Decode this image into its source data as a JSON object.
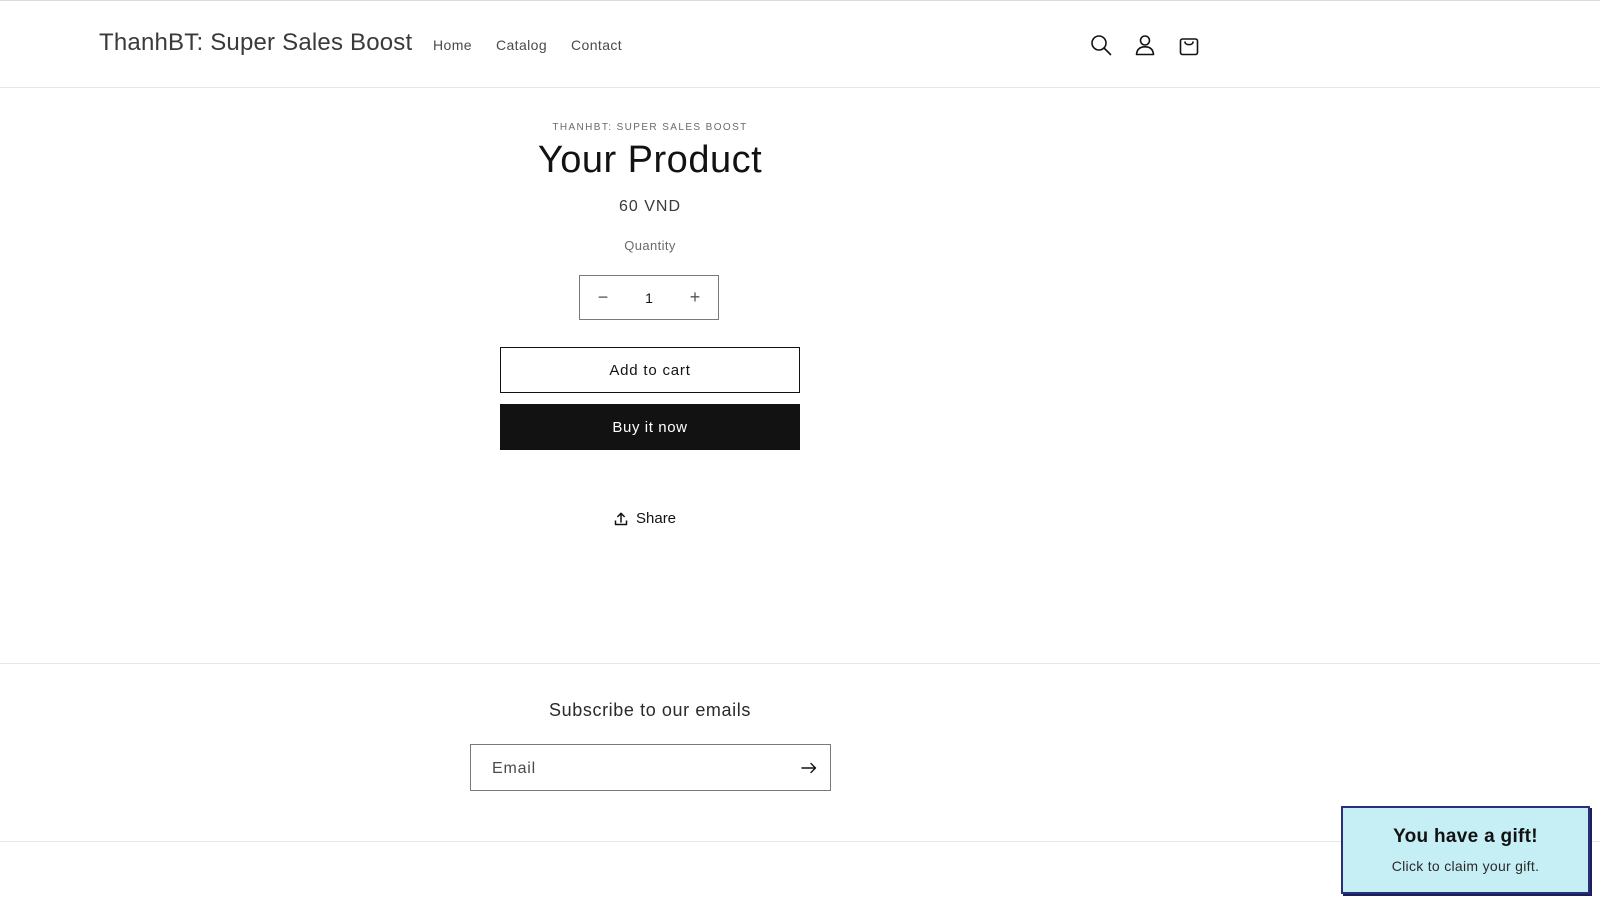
{
  "header": {
    "logo": "ThanhBT: Super Sales Boost",
    "nav": [
      "Home",
      "Catalog",
      "Contact"
    ],
    "icons": [
      "search-icon",
      "account-icon",
      "cart-icon"
    ]
  },
  "product": {
    "vendor": "THANHBT: SUPER SALES BOOST",
    "title": "Your Product",
    "price": "60 VND",
    "quantity_label": "Quantity",
    "quantity": "1",
    "decrease_symbol": "−",
    "increase_symbol": "+",
    "add_to_cart": "Add to cart",
    "buy_now": "Buy it now",
    "share": "Share"
  },
  "newsletter": {
    "title": "Subscribe to our emails",
    "email_placeholder": "Email"
  },
  "gift": {
    "title": "You have a gift!",
    "subtitle": "Click to claim your gift."
  },
  "colors": {
    "button_dark": "#121212",
    "gift_background": "#c6eff5",
    "gift_border": "#2a2f7a"
  }
}
